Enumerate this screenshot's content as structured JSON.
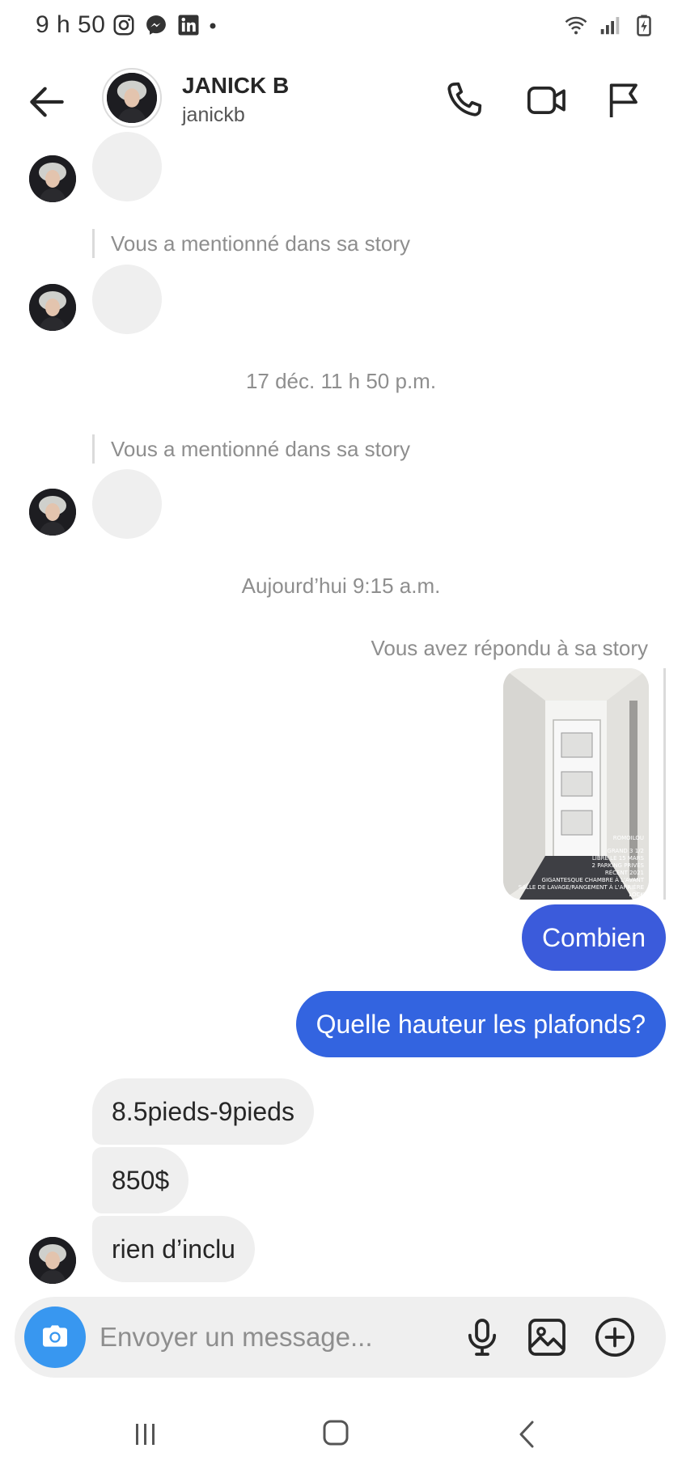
{
  "status_bar": {
    "time": "9 h 50"
  },
  "header": {
    "name": "JANICK B",
    "username": "janickb"
  },
  "conversation": {
    "mention_1": "Vous a mentionné dans sa story",
    "timestamp_1": "17 déc. 11 h 50 p.m.",
    "mention_2": "Vous a mentionné dans sa story",
    "timestamp_2": "Aujourd’hui 9:15 a.m.",
    "reply_note": "Vous avez répondu à sa story",
    "story_thumb_text": [
      "ROMOILOU",
      "GRAND 3 1/2",
      "LIBRE LE 15 MARS",
      "2 PARKING PRIVÉS",
      "RÉCENT 2021",
      "GIGANTESQUE CHAMBRE À L'AVANT",
      "SALLE DE LAVAGE/RANGEMENT À L'ARRIÈRE",
      "LOCK"
    ],
    "outgoing_1": "Combien",
    "outgoing_2": "Quelle hauteur les plafonds?",
    "incoming_1": "8.5pieds-9pieds",
    "incoming_2": "850$",
    "incoming_3": "rien d’inclu"
  },
  "composer": {
    "placeholder": "Envoyer un message..."
  },
  "colors": {
    "bubble_out_1": "#3b5bdb",
    "bubble_out_2": "#3364e0",
    "bubble_in": "#efefef",
    "camera": "#3897f0"
  },
  "icons": [
    "instagram-icon",
    "messenger-icon",
    "linkedin-icon",
    "wifi-icon",
    "signal-icon",
    "battery-icon",
    "back-arrow-icon",
    "phone-icon",
    "video-camera-icon",
    "flag-icon",
    "camera-icon",
    "microphone-icon",
    "gallery-icon",
    "plus-circle-icon",
    "recents-icon",
    "home-icon",
    "nav-back-icon"
  ]
}
